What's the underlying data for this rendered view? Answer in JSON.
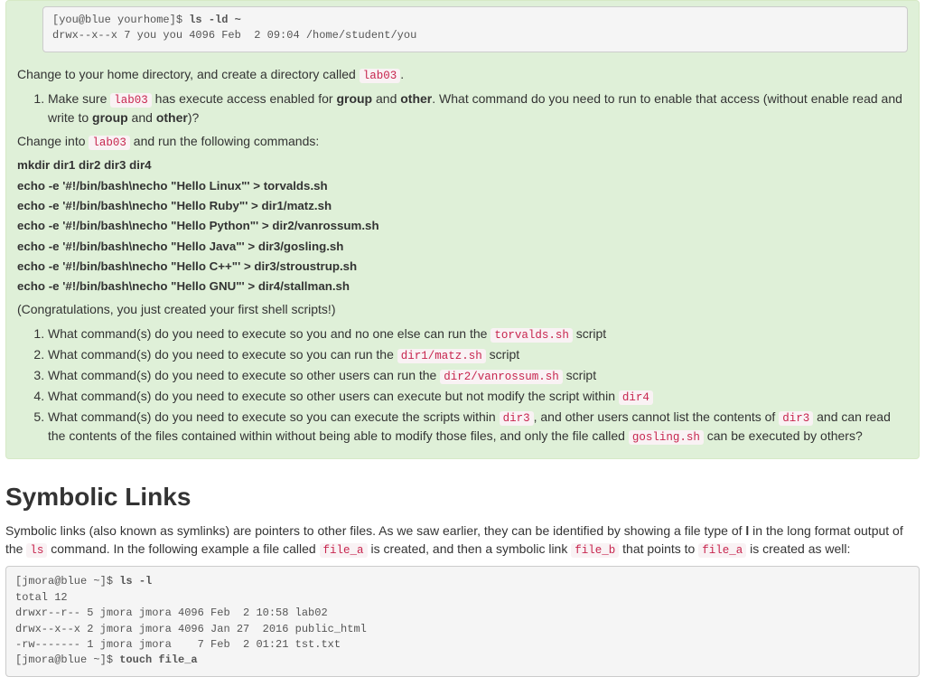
{
  "top_pre": {
    "line1_prompt": "[you@blue yourhome]$ ",
    "line1_cmd": "ls -ld ~",
    "line2": "drwx--x--x 7 you you 4096 Feb  2 09:04 /home/student/you"
  },
  "p_change": {
    "t1": "Change to your home directory, and create a directory called ",
    "code1": "lab03",
    "t2": "."
  },
  "ol1": {
    "i1": {
      "t1": "Make sure ",
      "code1": "lab03",
      "t2": " has execute access enabled for ",
      "b1": "group",
      "t3": " and ",
      "b2": "other",
      "t4": ". What command do you need to run to enable that access (without enable read and write to ",
      "b3": "group",
      "t5": " and ",
      "b4": "other",
      "t6": ")?"
    }
  },
  "p_into": {
    "t1": "Change into ",
    "code1": "lab03",
    "t2": " and run the following commands:"
  },
  "cmds": {
    "c1": "mkdir dir1 dir2 dir3 dir4",
    "c2": "echo -e '#!/bin/bash\\necho \"Hello Linux\"' > torvalds.sh",
    "c3": "echo -e '#!/bin/bash\\necho \"Hello Ruby\"' > dir1/matz.sh",
    "c4": "echo -e '#!/bin/bash\\necho \"Hello Python\"' > dir2/vanrossum.sh",
    "c5": "echo -e '#!/bin/bash\\necho \"Hello Java\"' > dir3/gosling.sh",
    "c6": "echo -e '#!/bin/bash\\necho \"Hello C++\"' > dir3/stroustrup.sh",
    "c7": "echo -e '#!/bin/bash\\necho \"Hello GNU\"' > dir4/stallman.sh"
  },
  "p_congrats": "(Congratulations, you just created your first shell scripts!)",
  "ol2": {
    "i1": {
      "t1": "What command(s) do you need to execute so you and no one else can run the ",
      "code1": "torvalds.sh",
      "t2": " script"
    },
    "i2": {
      "t1": "What command(s) do you need to execute so you can run the ",
      "code1": "dir1/matz.sh",
      "t2": " script"
    },
    "i3": {
      "t1": "What command(s) do you need to execute so other users can run the ",
      "code1": "dir2/vanrossum.sh",
      "t2": " script"
    },
    "i4": {
      "t1": "What command(s) do you need to execute so other users can execute but not modify the script within ",
      "code1": "dir4",
      "t2": ""
    },
    "i5": {
      "t1": "What command(s) do you need to execute so you can execute the scripts within ",
      "code1": "dir3",
      "t2": ", and other users cannot list the contents of ",
      "code2": "dir3",
      "t3": " and can read the contents of the files contained within without being able to modify those files, and only the file called ",
      "code3": "gosling.sh",
      "t4": " can be executed by others?"
    }
  },
  "h2": "Symbolic Links",
  "sym_para": {
    "t1": "Symbolic links (also known as symlinks) are pointers to other files. As we saw earlier, they can be identified by showing a file type of ",
    "b1": "l",
    "t2": " in the long format output of the ",
    "code1": "ls",
    "t3": " command. In the following example a file called ",
    "code2": "file_a",
    "t4": " is created, and then a symbolic link ",
    "code3": "file_b",
    "t5": " that points to ",
    "code4": "file_a",
    "t6": " is created as well:"
  },
  "bottom_pre": {
    "l1p": "[jmora@blue ~]$ ",
    "l1c": "ls -l",
    "l2": "total 12",
    "l3": "drwxr--r-- 5 jmora jmora 4096 Feb  2 10:58 lab02",
    "l4": "drwx--x--x 2 jmora jmora 4096 Jan 27  2016 public_html",
    "l5": "-rw------- 1 jmora jmora    7 Feb  2 01:21 tst.txt",
    "l6p": "[jmora@blue ~]$ ",
    "l6c": "touch file_a"
  }
}
